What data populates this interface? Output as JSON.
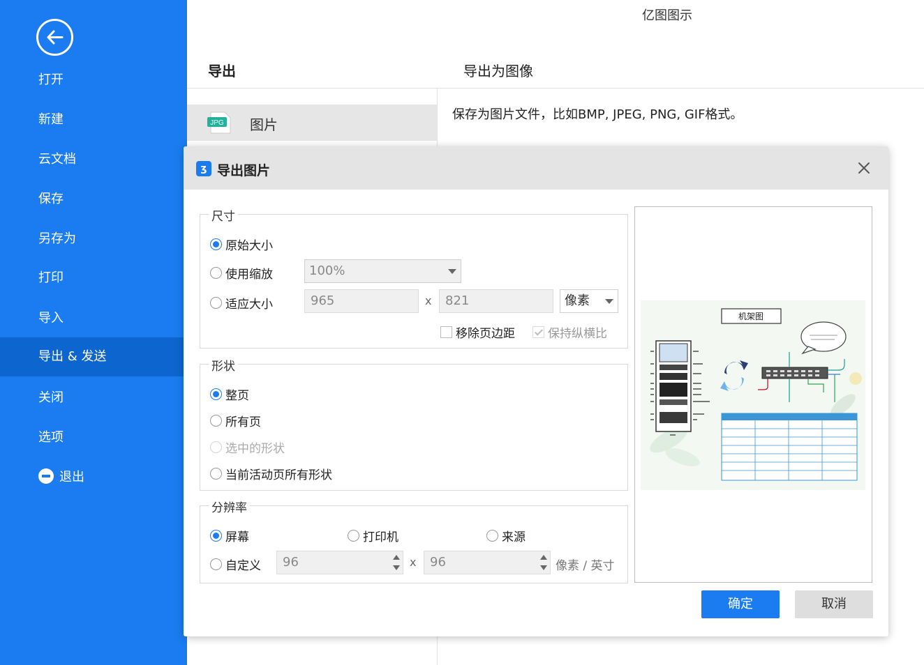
{
  "app": {
    "title": "亿图图示"
  },
  "sidebar": {
    "items": [
      {
        "label": "打开"
      },
      {
        "label": "新建"
      },
      {
        "label": "云文档"
      },
      {
        "label": "保存"
      },
      {
        "label": "另存为"
      },
      {
        "label": "打印"
      },
      {
        "label": "导入"
      },
      {
        "label": "导出 & 发送"
      },
      {
        "label": "关闭"
      },
      {
        "label": "选项"
      },
      {
        "label": "退出"
      }
    ],
    "active_index": 7
  },
  "main": {
    "section_title": "导出",
    "sub_title": "导出为图像",
    "nav_item": {
      "label": "图片",
      "icon_text": "JPG"
    },
    "description": "保存为图片文件，比如BMP, JPEG, PNG, GIF格式。"
  },
  "dialog": {
    "title": "导出图片",
    "size": {
      "legend": "尺寸",
      "original": "原始大小",
      "scale": "使用缩放",
      "scale_value": "100%",
      "fit": "适应大小",
      "width": "965",
      "height": "821",
      "times": "x",
      "unit": "像素",
      "remove_margin": "移除页边距",
      "keep_ratio": "保持纵横比",
      "selected": "original"
    },
    "shape": {
      "legend": "形状",
      "whole_page": "整页",
      "all_pages": "所有页",
      "selected_shape": "选中的形状",
      "active_page_shapes": "当前活动页所有形状",
      "selected": "whole_page"
    },
    "resolution": {
      "legend": "分辨率",
      "screen": "屏幕",
      "printer": "打印机",
      "source": "来源",
      "custom": "自定义",
      "x_dpi": "96",
      "y_dpi": "96",
      "times": "x",
      "unit": "像素 / 英寸",
      "selected": "screen"
    },
    "preview": {
      "diagram_title": "机架图"
    },
    "ok_label": "确定",
    "cancel_label": "取消",
    "colors": {
      "accent": "#1a7cf0",
      "sidebar_active": "#0d65cf"
    }
  }
}
